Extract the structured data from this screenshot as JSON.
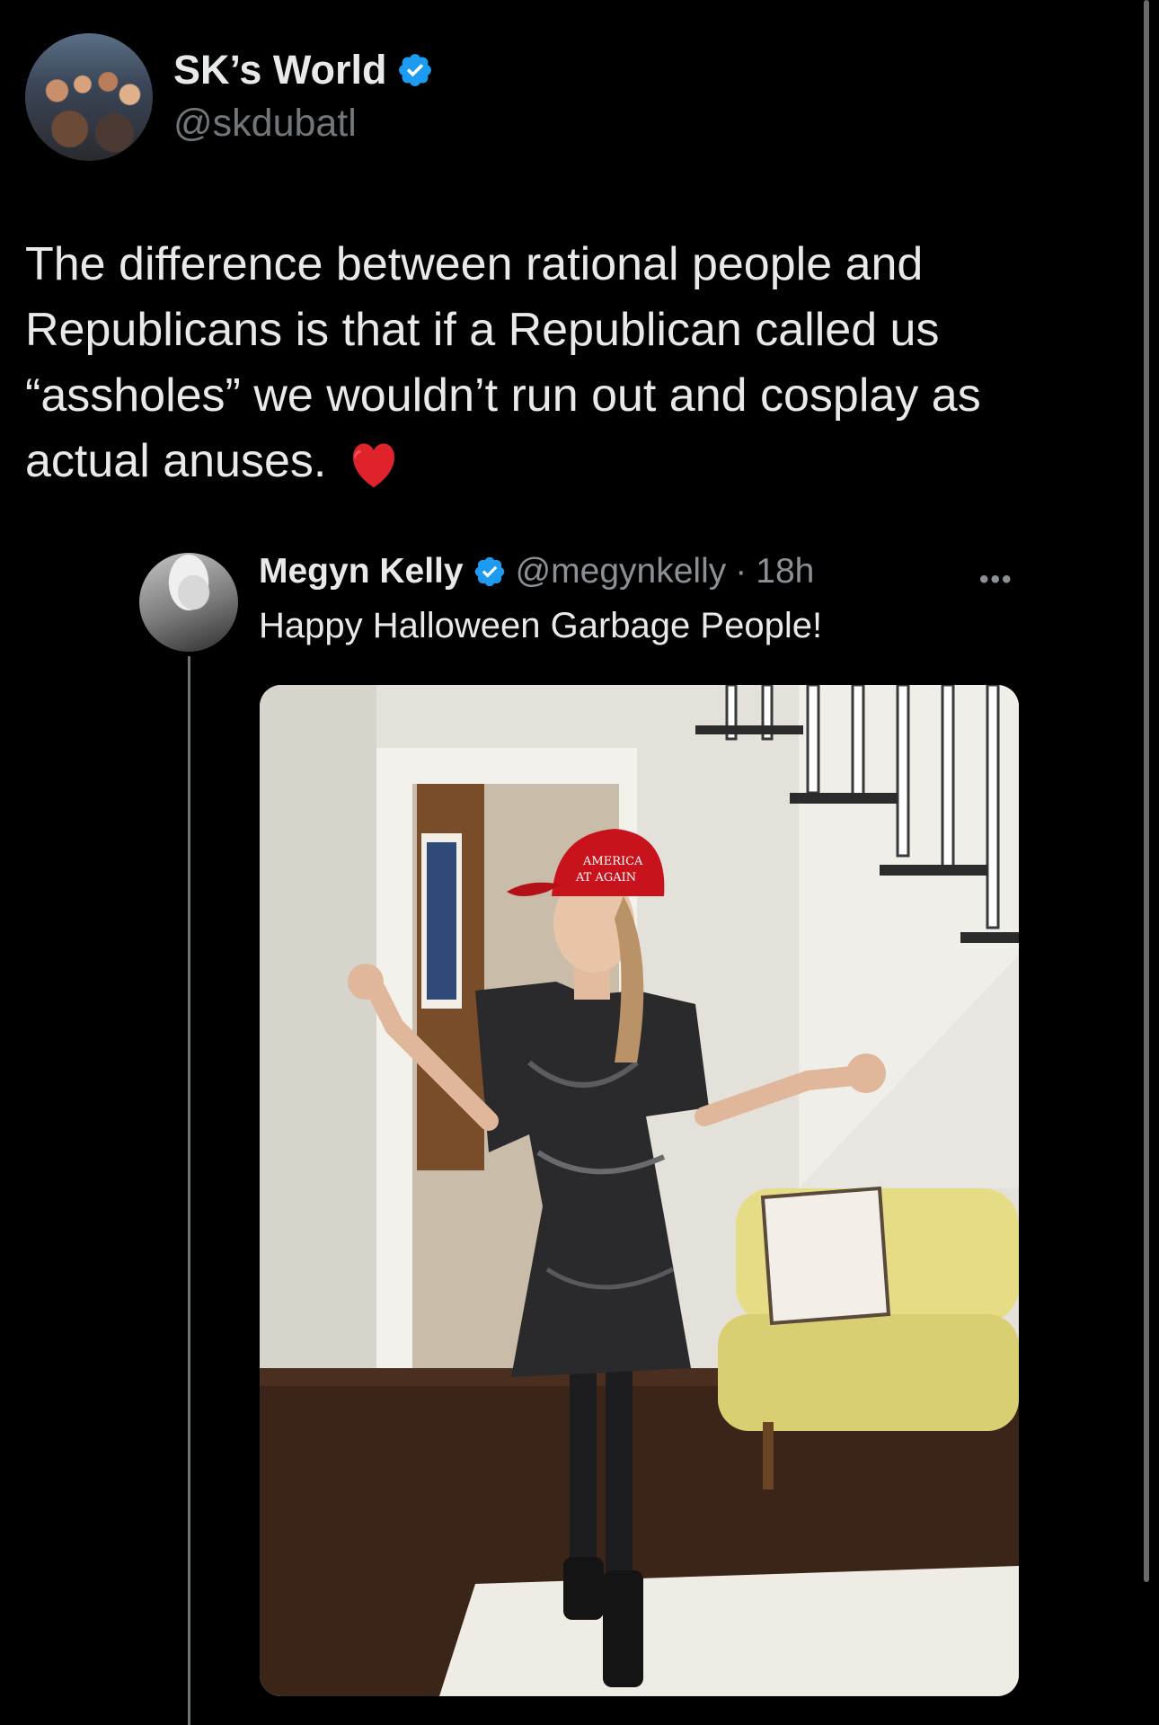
{
  "post": {
    "author": {
      "display_name": "SK’s World",
      "handle": "@skdubatl",
      "verified": true,
      "avatar_icon": "avatar-group-photo"
    },
    "text": "The difference between rational people and Republicans is that if a Republican called us “assholes” we wouldn’t run out and cosplay as actual anuses.",
    "emoji": "red-heart-icon",
    "accent_color": "#1d9bf0"
  },
  "quoted_post": {
    "author": {
      "display_name": "Megyn Kelly",
      "handle": "@megynkelly",
      "verified": true
    },
    "separator": "·",
    "time": "18h",
    "more_label": "•••",
    "text": "Happy Halloween Garbage People!",
    "media": {
      "cap_text_line1": "AMERICA",
      "cap_text_line2": "AT AGAIN"
    }
  }
}
